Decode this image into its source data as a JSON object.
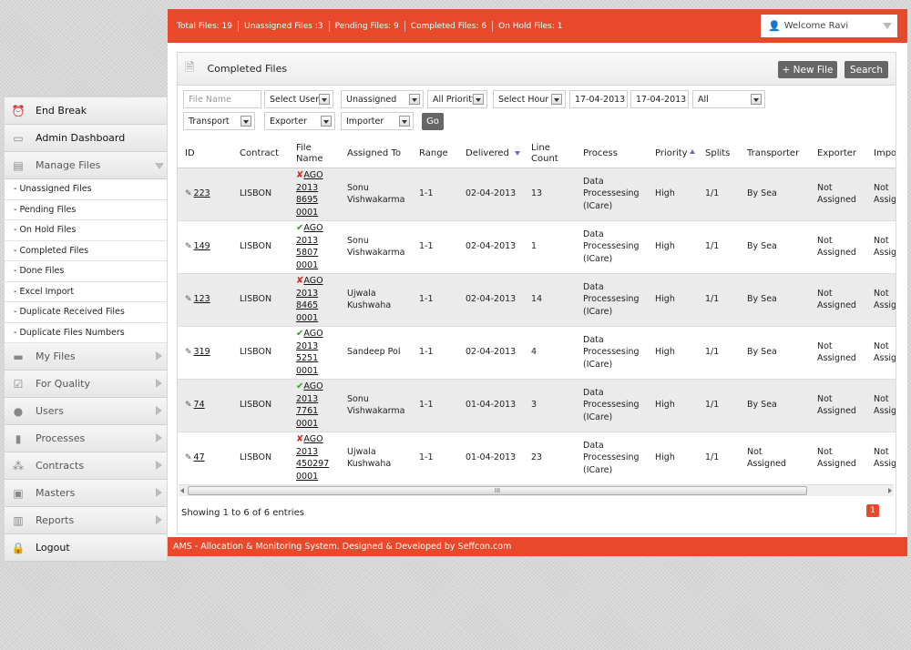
{
  "stats": {
    "total": "Total Files: 19",
    "unassigned": "Unassigned Files :3",
    "pending": "Pending Files: 9",
    "completed": "Completed Files: 6",
    "onhold": "On Hold Files: 1"
  },
  "welcome": "Welcome Ravi",
  "sidebar": {
    "end_break": "End Break",
    "admin_dashboard": "Admin Dashboard",
    "manage_files": "Manage Files",
    "submenu": [
      "- Unassigned Files",
      "- Pending Files",
      "- On Hold Files",
      "- Completed Files",
      "- Done Files",
      "- Excel Import",
      "- Duplicate Received Files",
      "- Duplicate Files Numbers"
    ],
    "my_files": "My Files",
    "for_quality": "For Quality",
    "users": "Users",
    "processes": "Processes",
    "contracts": "Contracts",
    "masters": "Masters",
    "reports": "Reports",
    "logout": "Logout"
  },
  "panel": {
    "title": "Completed Files",
    "new_file": "+ New File",
    "search": "Search"
  },
  "filters": {
    "file_name_placeholder": "File Name",
    "select_user": "Select User",
    "unassigned": "Unassigned",
    "all_priority": "All Priority",
    "select_hour": "Select Hour",
    "date_from": "17-04-2013",
    "date_to": "17-04-2013",
    "all": "All",
    "transport": "Transport",
    "exporter": "Exporter",
    "importer": "Importer",
    "go": "Go"
  },
  "table": {
    "headers": {
      "id": "ID",
      "contract": "Contract",
      "file_name_1": "File",
      "file_name_2": "Name",
      "assigned_to": "Assigned To",
      "range": "Range",
      "delivered": "Delivered",
      "line_count_1": "Line",
      "line_count_2": "Count",
      "process": "Process",
      "priority": "Priority",
      "splits": "Splits",
      "transporter": "Transporter",
      "exporter": "Exporter",
      "importer": "Impo"
    },
    "rows": [
      {
        "id": "223",
        "contract": "LISBON",
        "status": "bad",
        "fn": [
          "AGO",
          "2013",
          "8695",
          "0001"
        ],
        "assigned": [
          "Sonu",
          "Vishwakarma"
        ],
        "range": "1-1",
        "delivered": "02-04-2013",
        "lines": "13",
        "process": [
          "Data",
          "Processesing",
          "(ICare)"
        ],
        "priority": "High",
        "splits": "1/1",
        "transporter": [
          "By Sea"
        ],
        "exporter": [
          "Not",
          "Assigned"
        ],
        "importer": [
          "Not",
          "Assig"
        ]
      },
      {
        "id": "149",
        "contract": "LISBON",
        "status": "ok",
        "fn": [
          "AGO",
          "2013",
          "5807",
          "0001"
        ],
        "assigned": [
          "Sonu",
          "Vishwakarma"
        ],
        "range": "1-1",
        "delivered": "02-04-2013",
        "lines": "1",
        "process": [
          "Data",
          "Processesing",
          "(ICare)"
        ],
        "priority": "High",
        "splits": "1/1",
        "transporter": [
          "By Sea"
        ],
        "exporter": [
          "Not",
          "Assigned"
        ],
        "importer": [
          "Not",
          "Assig"
        ]
      },
      {
        "id": "123",
        "contract": "LISBON",
        "status": "bad",
        "fn": [
          "AGO",
          "2013",
          "8465",
          "0001"
        ],
        "assigned": [
          "Ujwala",
          "Kushwaha"
        ],
        "range": "1-1",
        "delivered": "02-04-2013",
        "lines": "14",
        "process": [
          "Data",
          "Processesing",
          "(ICare)"
        ],
        "priority": "High",
        "splits": "1/1",
        "transporter": [
          "By Sea"
        ],
        "exporter": [
          "Not",
          "Assigned"
        ],
        "importer": [
          "Not",
          "Assig"
        ]
      },
      {
        "id": "319",
        "contract": "LISBON",
        "status": "ok",
        "fn": [
          "AGO",
          "2013",
          "5251",
          "0001"
        ],
        "assigned": [
          "Sandeep Pol"
        ],
        "range": "1-1",
        "delivered": "02-04-2013",
        "lines": "4",
        "process": [
          "Data",
          "Processesing",
          "(ICare)"
        ],
        "priority": "High",
        "splits": "1/1",
        "transporter": [
          "By Sea"
        ],
        "exporter": [
          "Not",
          "Assigned"
        ],
        "importer": [
          "Not",
          "Assig"
        ]
      },
      {
        "id": "74",
        "contract": "LISBON",
        "status": "ok",
        "fn": [
          "AGO",
          "2013",
          "7761",
          "0001"
        ],
        "assigned": [
          "Sonu",
          "Vishwakarma"
        ],
        "range": "1-1",
        "delivered": "01-04-2013",
        "lines": "3",
        "process": [
          "Data",
          "Processesing",
          "(ICare)"
        ],
        "priority": "High",
        "splits": "1/1",
        "transporter": [
          "By Sea"
        ],
        "exporter": [
          "Not",
          "Assigned"
        ],
        "importer": [
          "Not",
          "Assig"
        ]
      },
      {
        "id": "47",
        "contract": "LISBON",
        "status": "bad",
        "fn": [
          "AGO",
          "2013",
          "450297",
          "0001"
        ],
        "assigned": [
          "Ujwala",
          "Kushwaha"
        ],
        "range": "1-1",
        "delivered": "01-04-2013",
        "lines": "23",
        "process": [
          "Data",
          "Processesing",
          "(ICare)"
        ],
        "priority": "High",
        "splits": "1/1",
        "transporter": [
          "Not",
          "Assigned"
        ],
        "exporter": [
          "Not",
          "Assigned"
        ],
        "importer": [
          "Not",
          "Assig"
        ]
      }
    ]
  },
  "showing": "Showing 1 to 6 of 6 entries",
  "page": "1",
  "footer": "AMS - Allocation & Monitoring System. Designed & Developed by Seffcon.com",
  "colors": {
    "accent": "#e8492a",
    "button": "#666666"
  }
}
